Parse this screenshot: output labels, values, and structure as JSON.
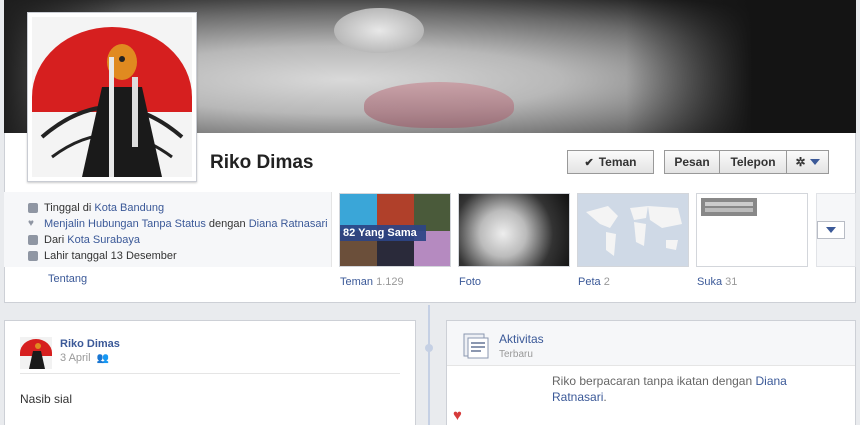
{
  "profile": {
    "name": "Riko Dimas",
    "buttons": {
      "friend": "Teman",
      "message": "Pesan",
      "call": "Telepon"
    },
    "info": {
      "lives_prefix": "Tinggal di",
      "lives_city": "Kota Bandung",
      "relationship_status": "Menjalin Hubungan Tanpa Status",
      "relationship_with_prefix": "dengan",
      "relationship_partner": "Diana Ratnasari",
      "from_prefix": "Dari",
      "from_city": "Kota Surabaya",
      "birthday": "Lahir tanggal 13 Desember"
    },
    "about_link": "Tentang",
    "thumbnails": [
      {
        "label": "Teman",
        "count": "1.129",
        "badge": "82 Yang Sama"
      },
      {
        "label": "Foto",
        "count": ""
      },
      {
        "label": "Peta",
        "count": "2"
      },
      {
        "label": "Suka",
        "count": "31"
      }
    ]
  },
  "post": {
    "author": "Riko Dimas",
    "date": "3 April",
    "text": "Nasib sial"
  },
  "activity": {
    "title": "Aktivitas",
    "subtitle": "Terbaru",
    "text_prefix": "Riko berpacaran tanpa ikatan dengan",
    "partner": "Diana Ratnasari",
    "text_suffix": "."
  },
  "colors": {
    "link": "#3b5998",
    "badge_bg": "#2d4486"
  },
  "icons": [
    "home-icon",
    "heart-icon",
    "house-icon",
    "calendar-icon",
    "gear-icon",
    "chevron-down-icon",
    "checkmark-icon",
    "friends-audience-icon",
    "activity-icon"
  ]
}
